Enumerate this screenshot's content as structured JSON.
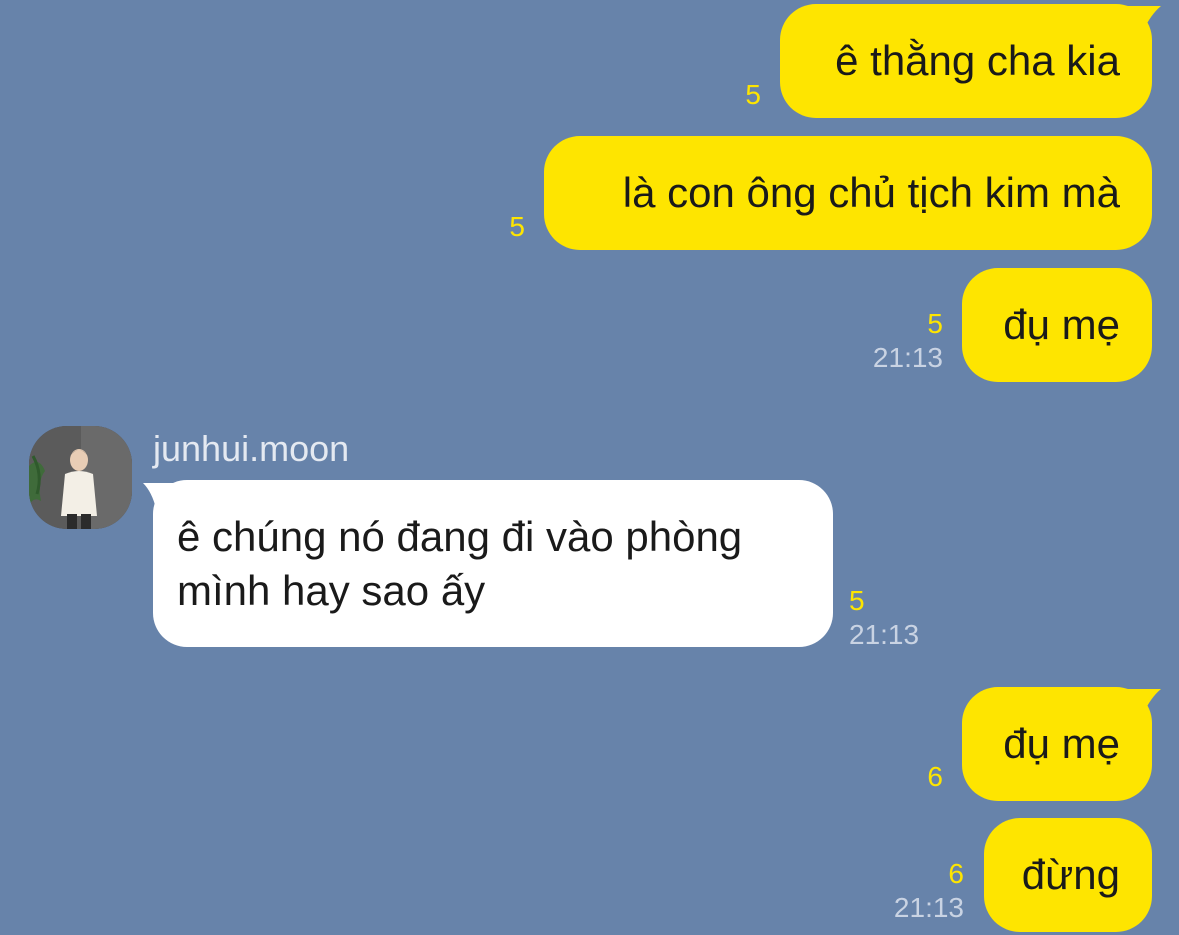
{
  "chat": {
    "messages": [
      {
        "text": "ê thằng cha kia",
        "unread": "5",
        "time": ""
      },
      {
        "text": "là con ông chủ tịch kim mà",
        "unread": "5",
        "time": ""
      },
      {
        "text": "đụ mẹ",
        "unread": "5",
        "time": "21:13"
      },
      {
        "sender": "junhui.moon",
        "text": "ê chúng nó đang đi vào phòng mình hay sao ấy",
        "unread": "5",
        "time": "21:13"
      },
      {
        "text": "đụ mẹ",
        "unread": "6",
        "time": ""
      },
      {
        "text": "đừng",
        "unread": "6",
        "time": "21:13"
      }
    ]
  },
  "colors": {
    "background": "#6783AA",
    "outgoing_bubble": "#FEE500",
    "incoming_bubble": "#FFFFFF",
    "unread_count": "#FEE500",
    "timestamp": "#C9D3E3"
  },
  "icons": {
    "avatar": "profile-photo"
  }
}
